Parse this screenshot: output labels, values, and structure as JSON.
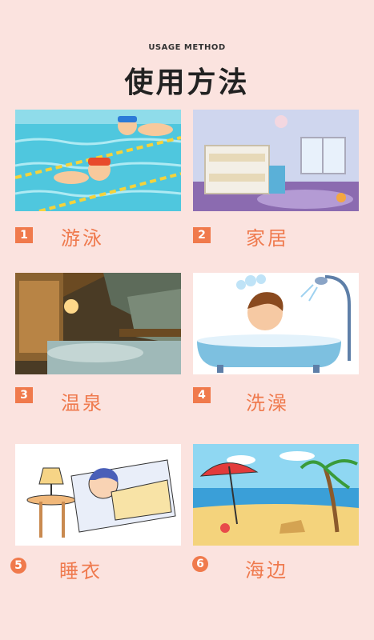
{
  "header": {
    "subtitle": "USAGE METHOD",
    "title": "使用方法"
  },
  "items": [
    {
      "number": "1",
      "label": "游泳",
      "icon": "swimming-illustration"
    },
    {
      "number": "2",
      "label": "家居",
      "icon": "kids-bedroom-photo"
    },
    {
      "number": "3",
      "label": "温泉",
      "icon": "hot-spring-photo"
    },
    {
      "number": "4",
      "label": "洗澡",
      "icon": "bathtub-boy-illustration"
    },
    {
      "number": "5",
      "label": "睡衣",
      "icon": "sleeping-child-illustration"
    },
    {
      "number": "6",
      "label": "海边",
      "icon": "beach-illustration"
    }
  ],
  "colors": {
    "background": "#fbe3df",
    "accent": "#ef7a4e",
    "title": "#222222"
  }
}
